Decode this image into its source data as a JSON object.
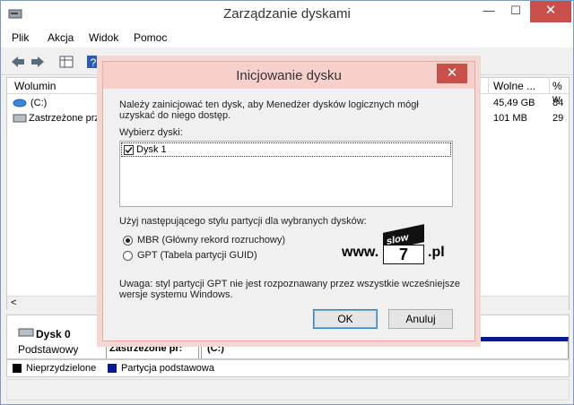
{
  "window": {
    "title": "Zarządzanie dyskami",
    "minimize": "—",
    "maximize": "☐",
    "close": "✕"
  },
  "menu": {
    "items": [
      "Plik",
      "Akcja",
      "Widok",
      "Pomoc"
    ]
  },
  "volume_list": {
    "columns": [
      "Wolumin",
      "Wolne ...",
      "% w"
    ],
    "rows": [
      {
        "name": "(C:)",
        "free": "45,49 GB",
        "pct": "84"
      },
      {
        "name": "Zastrzeżone prze",
        "free": "101 MB",
        "pct": "29"
      }
    ],
    "scroll_left": "<"
  },
  "disk_pane": {
    "disk_label": "Dysk 0",
    "disk_type": "Podstawowy",
    "partition1": "Zastrzeżone pr:",
    "partition2": "(C:)"
  },
  "legend": {
    "unallocated": "Nieprzydzielone",
    "primary": "Partycja podstawowa"
  },
  "dialog": {
    "title": "Inicjowanie dysku",
    "close": "✕",
    "intro_line1": "Należy zainicjować ten dysk, aby Menedżer dysków logicznych mógł",
    "intro_line2": "uzyskać do niego dostęp.",
    "select_label": "Wybierz dyski:",
    "disk_item": "Dysk 1",
    "partition_style_label": "Użyj następującego stylu partycji dla wybranych dysków:",
    "mbr_label": "MBR (Główny rekord rozruchowy)",
    "gpt_label": "GPT (Tabela partycji GUID)",
    "note_line1": "Uwaga: styl partycji GPT nie jest rozpoznawany przez wszystkie wcześniejsze",
    "note_line2": "wersje systemu Windows.",
    "ok_label": "OK",
    "cancel_label": "Anuluj"
  },
  "watermark": {
    "prefix": "www.",
    "badge_top": "slow",
    "badge_num": "7",
    "suffix": ".pl"
  }
}
